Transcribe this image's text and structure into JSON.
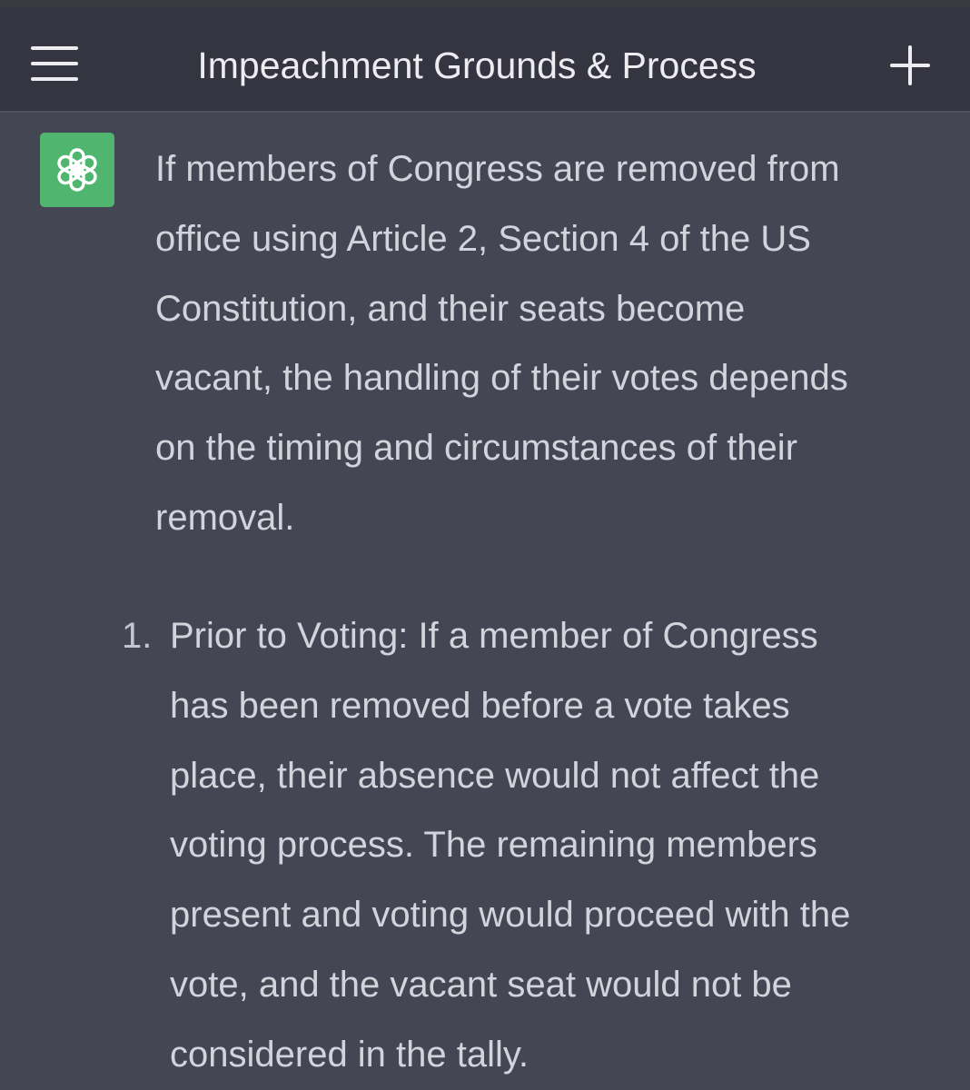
{
  "header": {
    "title": "Impeachment Grounds & Process",
    "menu_icon": "hamburger-menu-icon",
    "new_chat_icon": "plus-icon"
  },
  "assistant": {
    "avatar_icon": "openai-logo-icon",
    "avatar_color": "#4fb56f"
  },
  "message": {
    "intro": "If members of Congress are removed from\noffice using Article 2, Section 4 of the US\nConstitution, and their seats become\nvacant, the handling of their votes depends\non the timing and circumstances of their\nremoval.",
    "list": [
      {
        "number": "1.",
        "text": "Prior to Voting: If a member of Congress\nhas been removed before a vote takes\nplace, their absence would not affect the\nvoting process. The remaining members\npresent and voting would proceed with the\nvote, and the vacant seat would not be\nconsidered in the tally."
      }
    ]
  },
  "colors": {
    "background": "#444654",
    "header_background": "#343541",
    "text": "#d1d5db"
  }
}
